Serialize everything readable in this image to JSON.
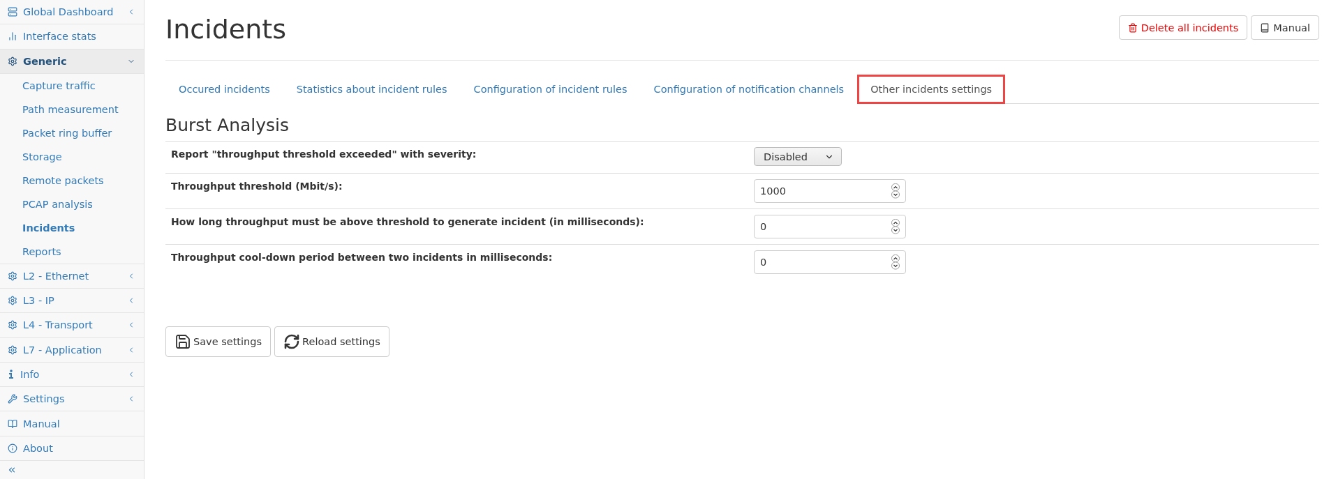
{
  "sidebar": {
    "items": [
      {
        "label": "Global Dashboard",
        "kind": "group",
        "expanded": false
      },
      {
        "label": "Interface stats",
        "kind": "link"
      },
      {
        "label": "Generic",
        "kind": "group",
        "expanded": true,
        "children": [
          {
            "label": "Capture traffic",
            "selected": false
          },
          {
            "label": "Path measurement",
            "selected": false
          },
          {
            "label": "Packet ring buffer",
            "selected": false
          },
          {
            "label": "Storage",
            "selected": false
          },
          {
            "label": "Remote packets",
            "selected": false
          },
          {
            "label": "PCAP analysis",
            "selected": false
          },
          {
            "label": "Incidents",
            "selected": true
          },
          {
            "label": "Reports",
            "selected": false
          }
        ]
      },
      {
        "label": "L2 - Ethernet",
        "kind": "group",
        "expanded": false
      },
      {
        "label": "L3 - IP",
        "kind": "group",
        "expanded": false
      },
      {
        "label": "L4 - Transport",
        "kind": "group",
        "expanded": false
      },
      {
        "label": "L7 - Application",
        "kind": "group",
        "expanded": false
      },
      {
        "label": "Info",
        "kind": "group",
        "expanded": false
      },
      {
        "label": "Settings",
        "kind": "group",
        "expanded": false
      },
      {
        "label": "Manual",
        "kind": "link"
      },
      {
        "label": "About",
        "kind": "link"
      }
    ]
  },
  "page": {
    "title": "Incidents",
    "buttons": [
      {
        "label": "Delete all incidents",
        "kind": "danger"
      },
      {
        "label": "Manual",
        "kind": "default"
      }
    ]
  },
  "tabs": [
    {
      "label": "Occured incidents",
      "selected": false
    },
    {
      "label": "Statistics about incident rules",
      "selected": false
    },
    {
      "label": "Configuration of incident rules",
      "selected": false
    },
    {
      "label": "Configuration of notification channels",
      "selected": false
    },
    {
      "label": "Other incidents settings",
      "selected": true
    }
  ],
  "section": {
    "title": "Burst Analysis",
    "rows": [
      {
        "label": "Report \"throughput threshold exceeded\" with severity:",
        "kind": "select",
        "value": "Disabled"
      },
      {
        "label": "Throughput threshold (Mbit/s):",
        "kind": "number",
        "value": "1000"
      },
      {
        "label": "How long throughput must be above threshold to generate incident (in milliseconds):",
        "kind": "number",
        "value": "0"
      },
      {
        "label": "Throughput cool-down period between two incidents in milliseconds:",
        "kind": "number",
        "value": "0"
      }
    ]
  },
  "actions": [
    {
      "label": "Save settings",
      "kind": "save"
    },
    {
      "label": "Reload settings",
      "kind": "reload"
    }
  ]
}
